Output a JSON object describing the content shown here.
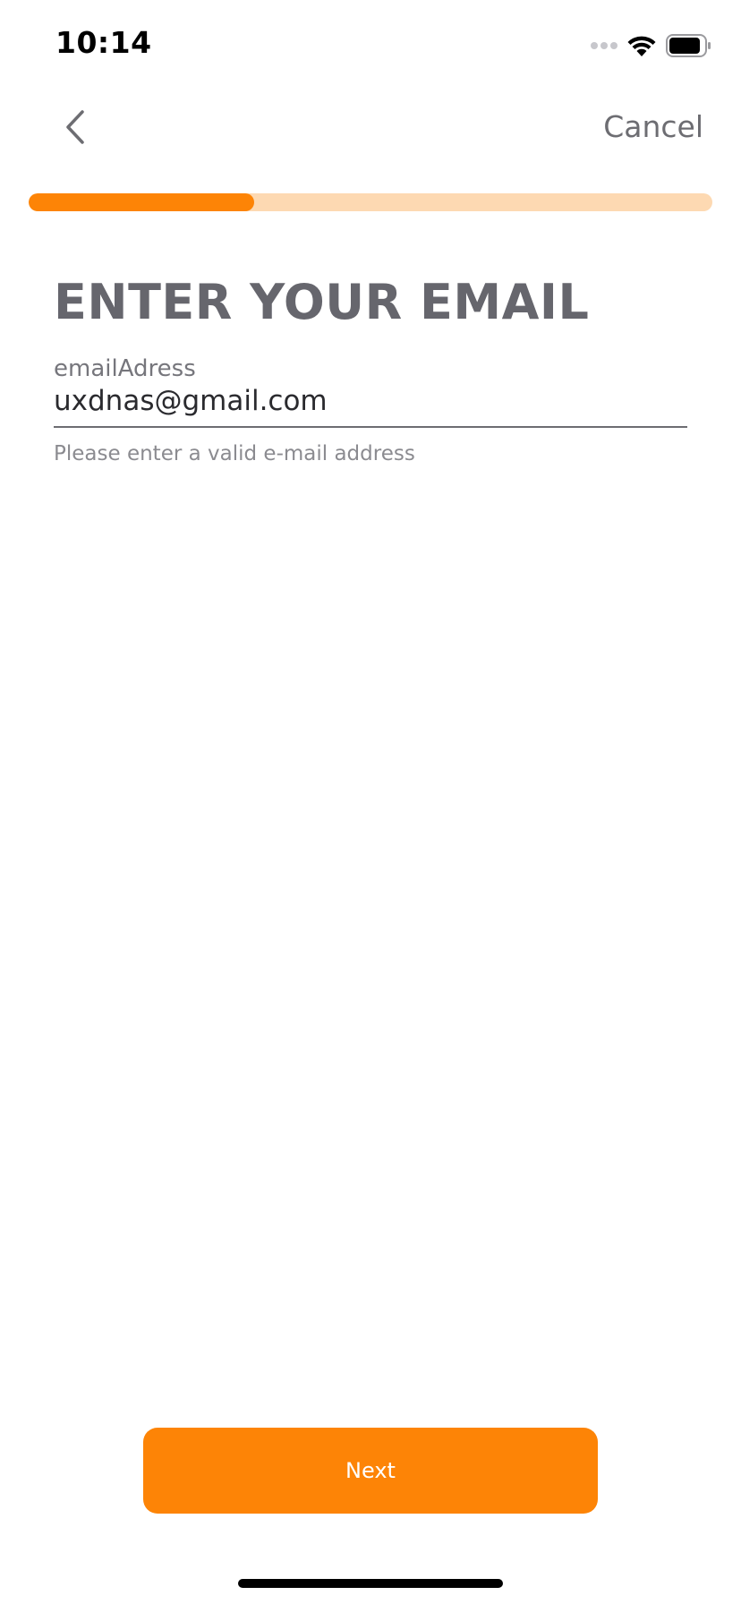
{
  "status_bar": {
    "time": "10:14",
    "icons": [
      "signal-icon",
      "wifi-icon",
      "battery-icon"
    ]
  },
  "nav": {
    "back_icon": "chevron-left-icon",
    "cancel_label": "Cancel"
  },
  "progress": {
    "fraction": 0.33,
    "fill_color": "#fd8406",
    "track_color": "#fdd9b2"
  },
  "page": {
    "title": "ENTER YOUR EMAIL"
  },
  "email_field": {
    "label": "emailAdress",
    "value": "uxdnas@gmail.com",
    "hint": "Please enter a valid e-mail address"
  },
  "actions": {
    "next_label": "Next"
  },
  "colors": {
    "accent": "#fd8406",
    "title_text": "#66666d",
    "muted_text": "#6d6d72"
  }
}
